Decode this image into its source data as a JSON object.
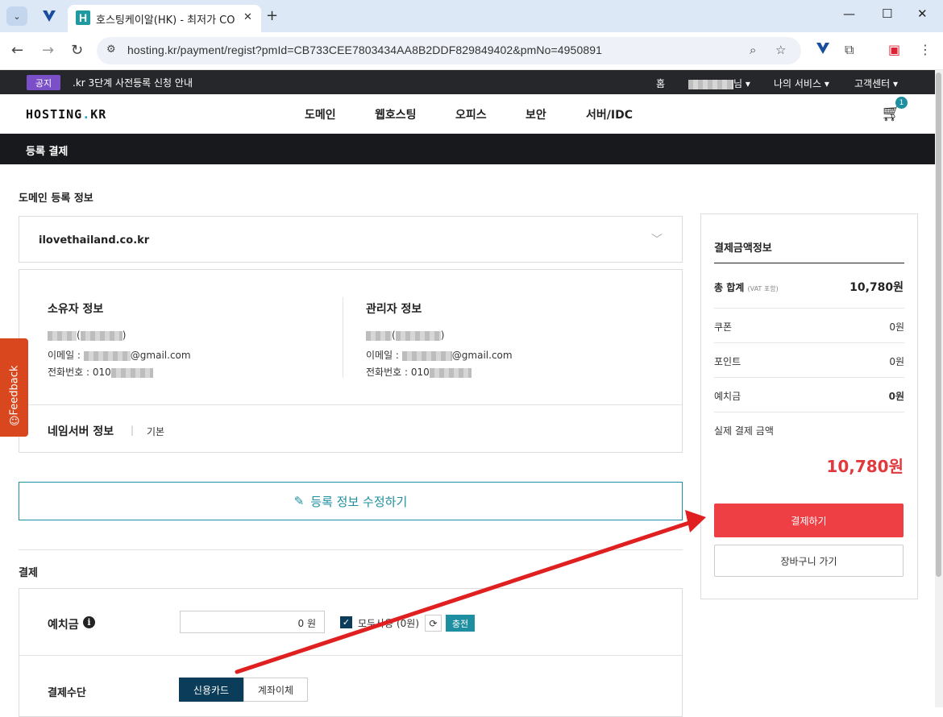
{
  "browser": {
    "tab_title": "호스팅케이알(HK) - 최저가 CO",
    "favicon_letter": "H",
    "url": "hosting.kr/payment/regist?pmId=CB733CEE7803434AA8B2DDF829849402&pmNo=4950891"
  },
  "notice": {
    "badge": "공지",
    "text": ".kr 3단계 사전등록 신청 안내"
  },
  "top_links": {
    "home": "홈",
    "user_suffix": "님 ▾",
    "my_services": "나의 서비스 ▾",
    "support": "고객센터 ▾"
  },
  "header": {
    "logo_a": "HOSTING",
    "logo_dot": ".",
    "logo_b": "KR",
    "nav": [
      "도메인",
      "웹호스팅",
      "오피스",
      "보안",
      "서버/IDC"
    ],
    "cart_count": "1"
  },
  "page_title": "등록 결제",
  "domain_section": {
    "label": "도메인 등록 정보",
    "domain": "ilovethailand.co.kr"
  },
  "owner": {
    "title": "소유자 정보",
    "paren_open": "(",
    "paren_close": ")",
    "email_prefix": "이메일 : ",
    "email_suffix": "@gmail.com",
    "phone_prefix": "전화번호 : 010"
  },
  "admin": {
    "title": "관리자 정보",
    "paren_open": "(",
    "paren_close": ")",
    "email_prefix": "이메일 : ",
    "email_suffix": "@gmail.com",
    "phone_prefix": "전화번호 : 010"
  },
  "nameserver": {
    "title": "네임서버 정보",
    "separator": "|",
    "value": "기본"
  },
  "edit_button": "등록 정보 수정하기",
  "payment_section": {
    "label": "결제",
    "deposit_label": "예치금",
    "deposit_value": "0  원",
    "use_all": "모두사용 (0원)",
    "charge": "충전",
    "method_label": "결제수단",
    "method_card": "신용카드",
    "method_transfer": "계좌이체"
  },
  "summary": {
    "title": "결제금액정보",
    "total_label": "총 합계",
    "vat_note": "(VAT 포함)",
    "total_value": "10,780원",
    "coupon_label": "쿠폰",
    "coupon_value": "0원",
    "point_label": "포인트",
    "point_value": "0원",
    "deposit_label": "예치금",
    "deposit_value": "0원",
    "actual_label": "실제 결제 금액",
    "actual_value": "10,780원",
    "pay_button": "결제하기",
    "cart_button": "장바구니 가기"
  },
  "feedback": "Feedback",
  "colors": {
    "accent": "#1e8fa0",
    "pay": "#ee3f44",
    "price": "#e0393e",
    "annotation_arrow": "#e02020"
  }
}
